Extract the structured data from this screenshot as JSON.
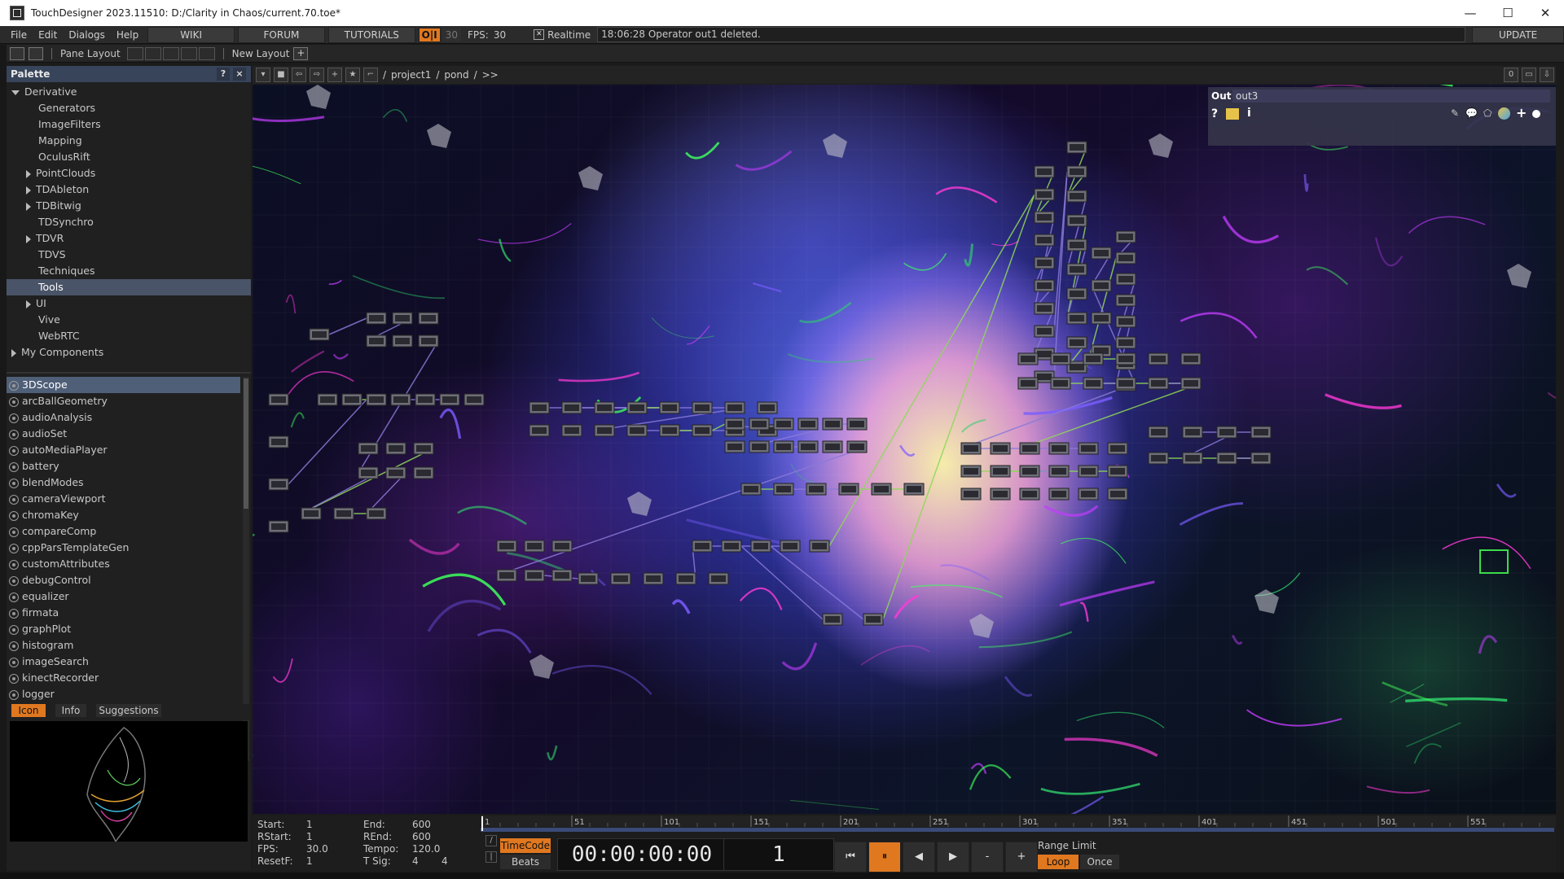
{
  "window": {
    "title": "TouchDesigner 2023.11510: D:/Clarity in Chaos/current.70.toe*",
    "minimize": "—",
    "maximize": "☐",
    "close": "✕"
  },
  "menu": {
    "items": [
      "File",
      "Edit",
      "Dialogs",
      "Help"
    ],
    "wiki": "WIKI",
    "forum": "FORUM",
    "tutorials": "TUTORIALS",
    "oi": "O|I",
    "fps_small": "30",
    "fps_label": "FPS:",
    "fps_value": "30",
    "realtime_label": "Realtime",
    "realtime_checked": true,
    "status_message": "18:06:28 Operator out1 deleted.",
    "update": "UPDATE"
  },
  "toolbar": {
    "pane_layout": "Pane Layout",
    "new_layout": "New Layout",
    "add": "+"
  },
  "palette": {
    "title": "Palette",
    "help": "?",
    "close": "×",
    "tree": [
      {
        "label": "Derivative",
        "level": 0,
        "arrow": "down",
        "selected": false
      },
      {
        "label": "Generators",
        "level": 2,
        "arrow": "none",
        "selected": false
      },
      {
        "label": "ImageFilters",
        "level": 2,
        "arrow": "none",
        "selected": false
      },
      {
        "label": "Mapping",
        "level": 2,
        "arrow": "none",
        "selected": false
      },
      {
        "label": "OculusRift",
        "level": 2,
        "arrow": "none",
        "selected": false
      },
      {
        "label": "PointClouds",
        "level": 1,
        "arrow": "right",
        "selected": false
      },
      {
        "label": "TDAbleton",
        "level": 1,
        "arrow": "right",
        "selected": false
      },
      {
        "label": "TDBitwig",
        "level": 1,
        "arrow": "right",
        "selected": false
      },
      {
        "label": "TDSynchro",
        "level": 2,
        "arrow": "none",
        "selected": false
      },
      {
        "label": "TDVR",
        "level": 1,
        "arrow": "right",
        "selected": false
      },
      {
        "label": "TDVS",
        "level": 2,
        "arrow": "none",
        "selected": false
      },
      {
        "label": "Techniques",
        "level": 2,
        "arrow": "none",
        "selected": false
      },
      {
        "label": "Tools",
        "level": 2,
        "arrow": "none",
        "selected": true
      },
      {
        "label": "UI",
        "level": 1,
        "arrow": "right",
        "selected": false
      },
      {
        "label": "Vive",
        "level": 2,
        "arrow": "none",
        "selected": false
      },
      {
        "label": "WebRTC",
        "level": 2,
        "arrow": "none",
        "selected": false
      },
      {
        "label": "My Components",
        "level": 0,
        "arrow": "right",
        "selected": false
      }
    ],
    "components": [
      "3DScope",
      "arcBallGeometry",
      "audioAnalysis",
      "audioSet",
      "autoMediaPlayer",
      "battery",
      "blendModes",
      "cameraViewport",
      "chromaKey",
      "compareComp",
      "cppParsTemplateGen",
      "customAttributes",
      "debugControl",
      "equalizer",
      "firmata",
      "graphPlot",
      "histogram",
      "imageSearch",
      "kinectRecorder",
      "logger"
    ],
    "selected_component": "3DScope",
    "tabs": {
      "icon": "Icon",
      "info": "Info",
      "suggestions": "Suggestions"
    }
  },
  "network": {
    "path": [
      "project1",
      "pond",
      ">>"
    ],
    "right_value": "0"
  },
  "viewer": {
    "label": "Out",
    "name": "out3"
  },
  "timeline": {
    "start_label": "Start:",
    "start": "1",
    "rstart_label": "RStart:",
    "rstart": "1",
    "fps_label": "FPS:",
    "fps": "30.0",
    "resetf_label": "ResetF:",
    "resetf": "1",
    "end_label": "End:",
    "end": "600",
    "rend_label": "REnd:",
    "rend": "600",
    "tempo_label": "Tempo:",
    "tempo": "120.0",
    "tsig_label": "T Sig:",
    "tsig_a": "4",
    "tsig_b": "4",
    "ruler": [
      "1",
      "51",
      "101",
      "151",
      "201",
      "251",
      "301",
      "351",
      "401",
      "451",
      "501",
      "551"
    ],
    "timecode": "TimeCode",
    "beats": "Beats",
    "time_display": "00:00:00:00",
    "frame": "1",
    "range_limit": "Range Limit",
    "loop": "Loop",
    "once": "Once"
  },
  "colors": {
    "accent_orange": "#e07820",
    "palette_header": "#37445a",
    "selection": "#4a5468",
    "node_green": "#8fd85a",
    "node_purple": "#8a7ad8"
  }
}
